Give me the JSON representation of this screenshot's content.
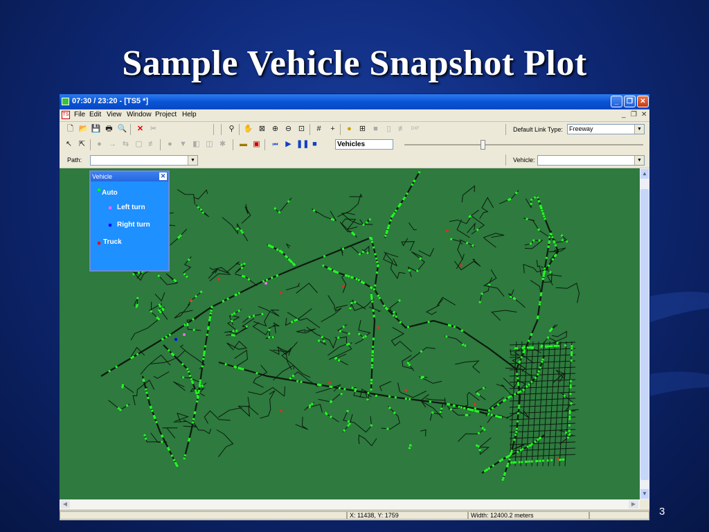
{
  "slide": {
    "title": "Sample Vehicle Snapshot Plot",
    "number": "3"
  },
  "window": {
    "title": "07:30 / 23:20 - [TS5 *]",
    "controls": {
      "minimize": "_",
      "restore": "❐",
      "close": "✕"
    }
  },
  "menubar": {
    "items": [
      "File",
      "Edit",
      "View",
      "Window",
      "Project",
      "Help"
    ],
    "mdi": {
      "minimize": "_",
      "restore": "❐",
      "close": "✕"
    }
  },
  "toolbar1": {
    "link_type_label": "Default Link Type:",
    "link_type_value": "Freeway"
  },
  "toolbar2": {
    "layer_value": "Vehicles"
  },
  "toolbar3": {
    "path_label": "Path:",
    "path_value": "",
    "vehicle_label": "Vehicle:",
    "vehicle_value": ""
  },
  "legend": {
    "title": "Vehicle",
    "close": "✕",
    "entries": [
      {
        "label": "Auto",
        "color": "#00ff00"
      },
      {
        "label": "Left turn",
        "color": "#ff66ff"
      },
      {
        "label": "Right turn",
        "color": "#0000ff"
      },
      {
        "label": "Truck",
        "color": "#ff0000"
      }
    ]
  },
  "map": {
    "background": "#2e7a3f",
    "road_color": "#0b1a0b",
    "vehicle_color": "#22ff22"
  },
  "statusbar": {
    "coords": "X: 11438, Y: 1759",
    "width": "Width: 12400.2 meters"
  }
}
